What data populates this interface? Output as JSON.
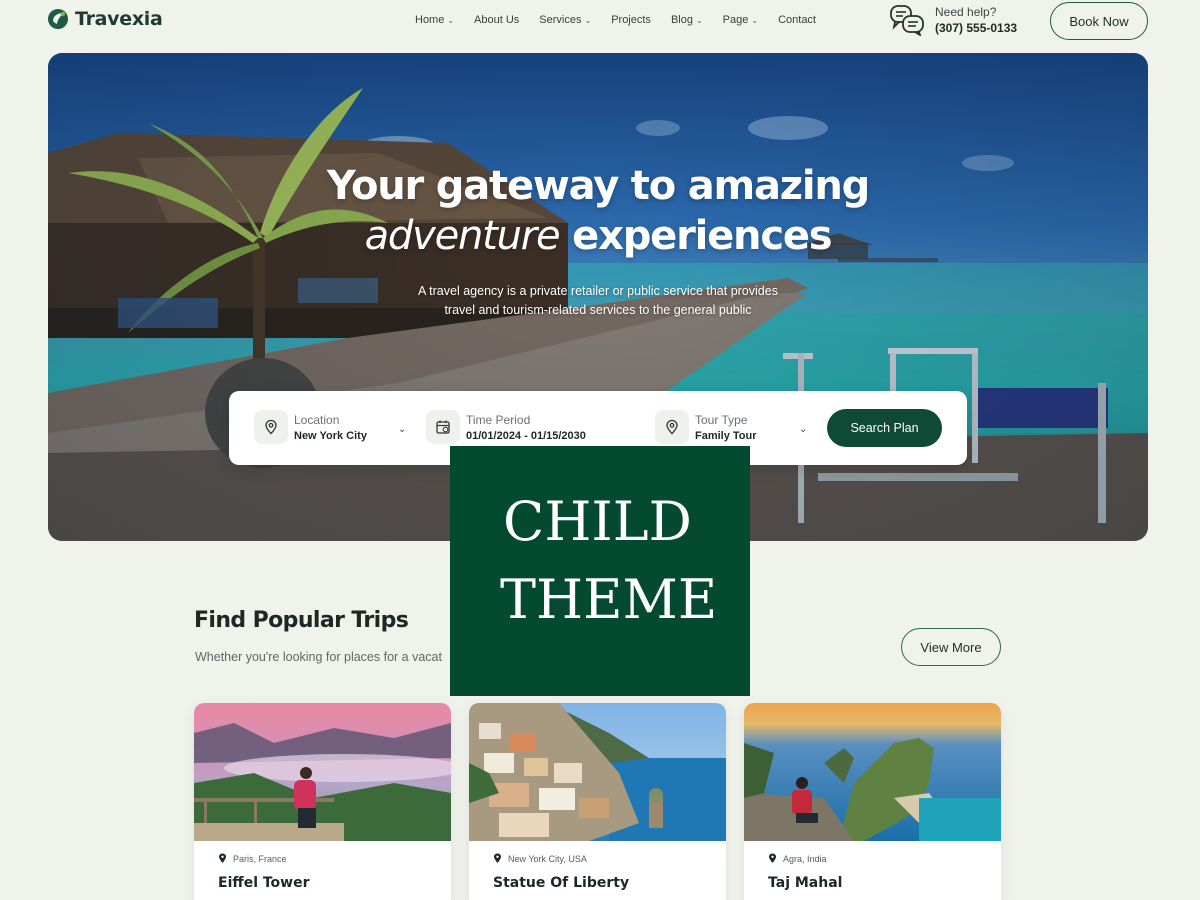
{
  "brand": {
    "name": "Travexia",
    "accent": "#0e4a35"
  },
  "nav": [
    {
      "label": "Home",
      "dropdown": true
    },
    {
      "label": "About Us",
      "dropdown": false
    },
    {
      "label": "Services",
      "dropdown": true
    },
    {
      "label": "Projects",
      "dropdown": false
    },
    {
      "label": "Blog",
      "dropdown": true
    },
    {
      "label": "Page",
      "dropdown": true
    },
    {
      "label": "Contact",
      "dropdown": false
    }
  ],
  "help": {
    "label": "Need help?",
    "phone": "(307) 555-0133"
  },
  "header": {
    "book_label": "Book Now"
  },
  "hero": {
    "title_line1": "Your gateway to amazing",
    "title_line2_italic": "adventure",
    "title_line2_rest": " experiences",
    "subtitle_line1": "A travel agency is a private retailer or public service that provides",
    "subtitle_line2": "travel and tourism-related services to the general public"
  },
  "search": {
    "location": {
      "label": "Location",
      "value": "New York City"
    },
    "period": {
      "label": "Time Period",
      "value": "01/01/2024 - 01/15/2030"
    },
    "tour": {
      "label": "Tour Type",
      "value": "Family Tour"
    },
    "button_label": "Search Plan"
  },
  "popular": {
    "title": "Find Popular Trips",
    "subtitle": "Whether you're looking for places for a vacat",
    "view_more_label": "View More"
  },
  "trips": [
    {
      "location": "Paris, France",
      "name": "Eiffel Tower"
    },
    {
      "location": "New York City, USA",
      "name": "Statue Of Liberty"
    },
    {
      "location": "Agra, India",
      "name": "Taj Mahal"
    }
  ],
  "badge": {
    "line1": "CHILD",
    "line2": "THEME",
    "color": "#044a31"
  }
}
